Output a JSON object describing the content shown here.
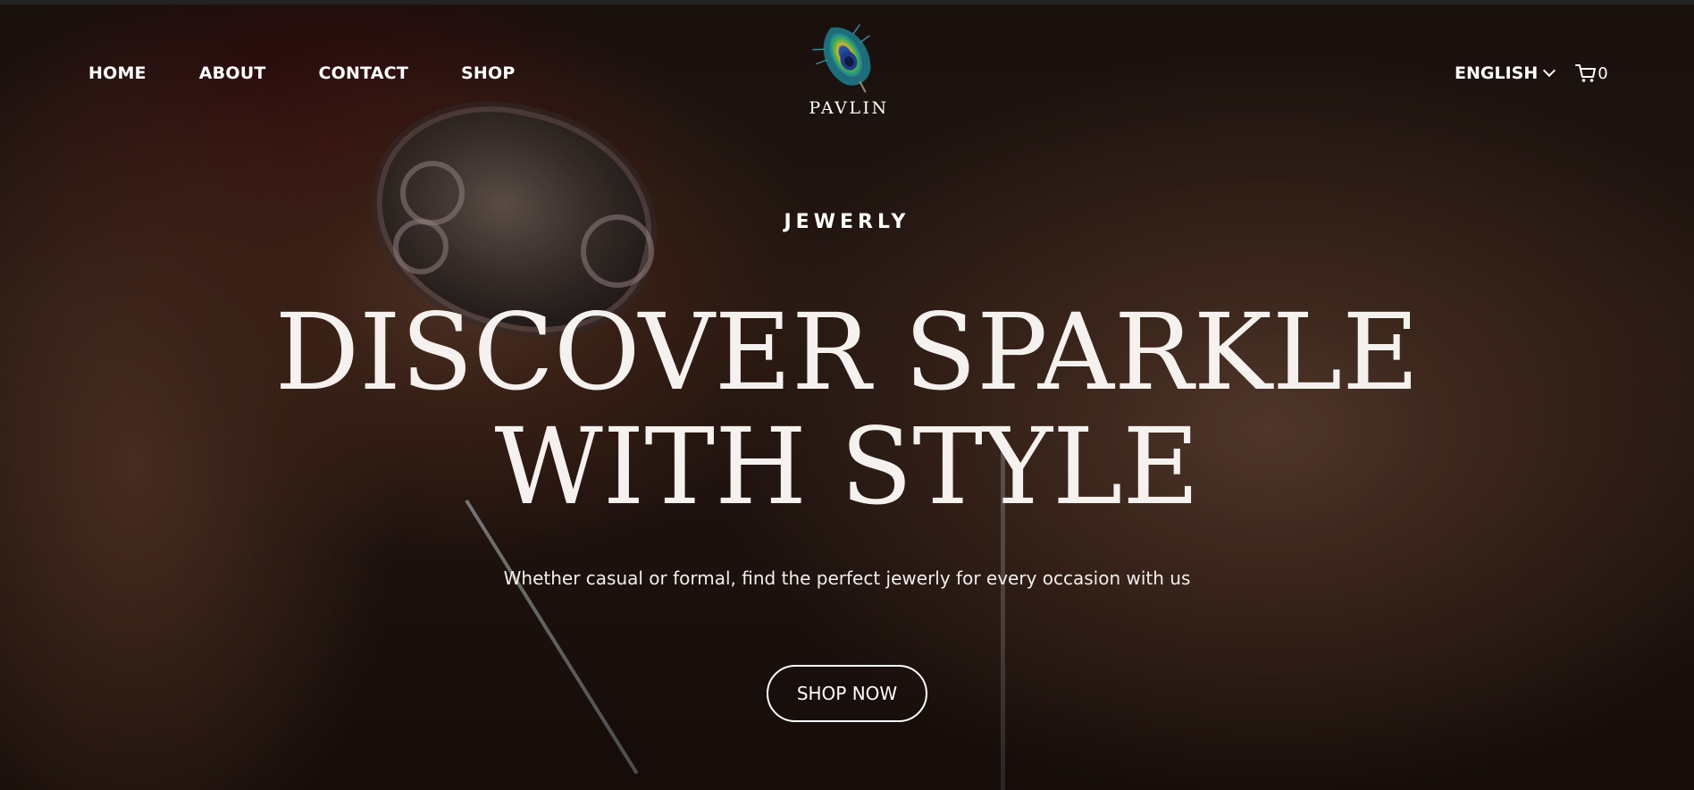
{
  "brand": {
    "name": "PAVLIN",
    "logo_icon": "peacock-feather-icon"
  },
  "nav": {
    "items": [
      {
        "label": "HOME"
      },
      {
        "label": "ABOUT"
      },
      {
        "label": "CONTACT"
      },
      {
        "label": "SHOP"
      }
    ],
    "language": "ENGLISH",
    "language_icon": "chevron-down-icon",
    "cart_icon": "shopping-cart-icon",
    "cart_count": "0"
  },
  "hero": {
    "eyebrow": "JEWERLY",
    "headline_line1": "DISCOVER SPARKLE",
    "headline_line2": "WITH STYLE",
    "subtext": "Whether casual or formal, find the perfect jewerly for every occasion with us",
    "cta_label": "SHOP NOW"
  },
  "colors": {
    "text": "#ffffff",
    "feather_teal": "#1f8f8a",
    "feather_blue": "#1e4fa0",
    "feather_gold": "#d9b13a"
  }
}
